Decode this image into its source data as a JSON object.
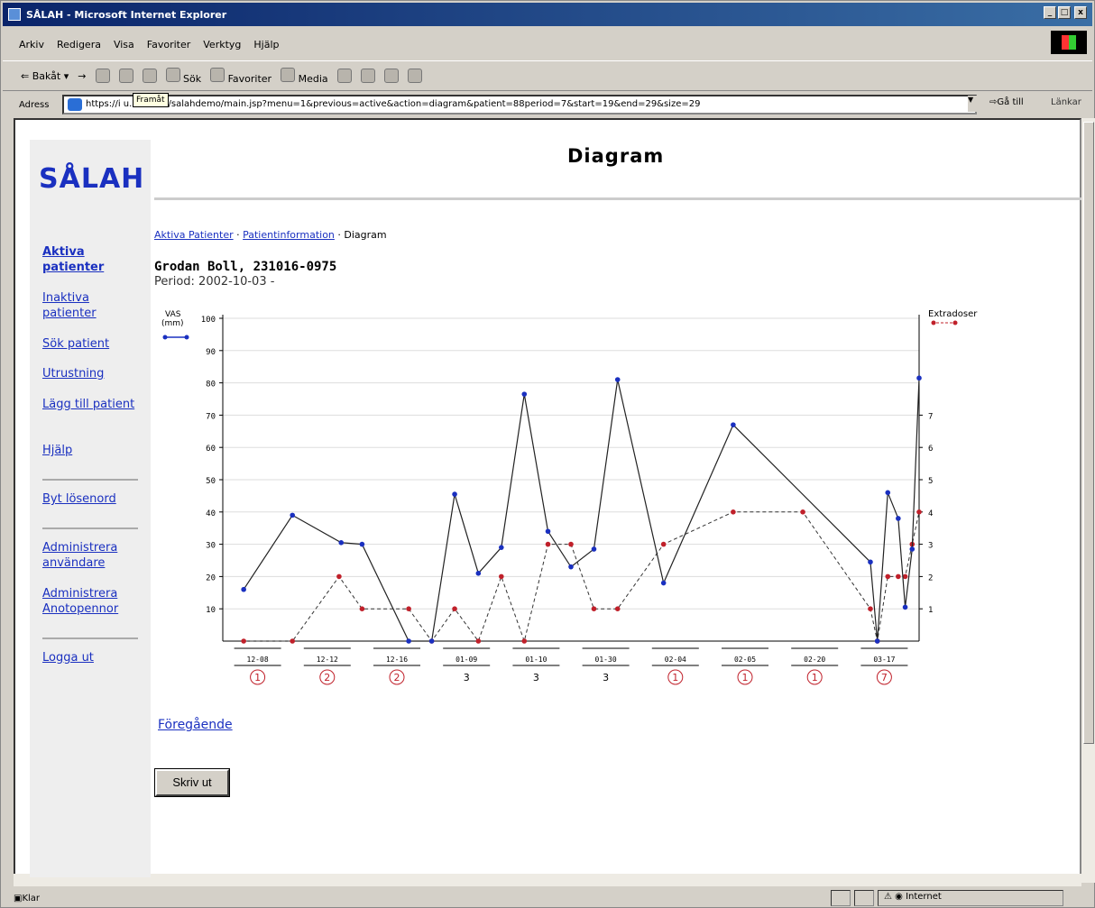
{
  "window": {
    "title": "SÅLAH - Microsoft Internet Explorer",
    "controls": {
      "minimize": "_",
      "restore": "□",
      "close": "x"
    }
  },
  "menubar": {
    "items": [
      "Arkiv",
      "Redigera",
      "Visa",
      "Favoriter",
      "Verktyg",
      "Hjälp"
    ]
  },
  "toolbar": {
    "back": "Bakåt",
    "forward": "→",
    "search": "Sök",
    "favorites": "Favoriter",
    "media": "Media"
  },
  "address": {
    "label": "Adress",
    "url": "https://i         u.se:8443/salahdemo/main.jsp?menu=1&previous=active&action=diagram&patient=88period=7&start=19&end=29&size=29",
    "tooltip": "Framåt",
    "go": "Gå till",
    "links": "Länkar"
  },
  "status": {
    "text": "Klar",
    "zone": "Internet"
  },
  "sidebar": {
    "logo": "SÅLAH",
    "links": [
      "Aktiva patienter",
      "Inaktiva patienter",
      "Sök patient",
      "Utrustning",
      "Lägg till patient",
      "Hjälp",
      "Byt lösenord",
      "Administrera användare",
      "Administrera Anotopennor",
      "Logga ut"
    ]
  },
  "main": {
    "title": "Diagram",
    "breadcrumb": {
      "crumb1": "Aktiva Patienter",
      "crumb2": "Patientinformation",
      "current": "Diagram",
      "sep": "·"
    },
    "patient": "Grodan Boll, 231016-0975",
    "period": "Period: 2002-10-03 -",
    "prev_link": "Föregående",
    "print_button": "Skriv ut"
  },
  "chart_data": {
    "type": "line",
    "left_axis_label_line1": "VAS",
    "left_axis_label_line2": "(mm)",
    "right_axis_label": "Extradoser",
    "ylim": [
      0,
      100
    ],
    "yticks": [
      10,
      20,
      30,
      40,
      50,
      60,
      70,
      80,
      90,
      100
    ],
    "y2lim": [
      0,
      10
    ],
    "y2ticks": [
      1,
      2,
      3,
      4,
      5,
      6,
      7
    ],
    "colors": {
      "vas": "#1a30c0",
      "extra": "#c0202a",
      "line": "#222222"
    },
    "groups": [
      {
        "date": "12-08",
        "count": "1",
        "circled": true
      },
      {
        "date": "12-12",
        "count": "2",
        "circled": true
      },
      {
        "date": "12-16",
        "count": "2",
        "circled": true
      },
      {
        "date": "01-09",
        "count": "3",
        "circled": false
      },
      {
        "date": "01-10",
        "count": "3",
        "circled": false
      },
      {
        "date": "01-30",
        "count": "3",
        "circled": false
      },
      {
        "date": "02-04",
        "count": "1",
        "circled": true
      },
      {
        "date": "02-05",
        "count": "1",
        "circled": true
      },
      {
        "date": "02-20",
        "count": "1",
        "circled": true
      },
      {
        "date": "03-17",
        "count": "7",
        "circled": true
      }
    ],
    "series": [
      {
        "name": "VAS",
        "style": "solid",
        "points": [
          [
            0.3,
            16
          ],
          [
            1,
            39
          ],
          [
            1.7,
            30.5
          ],
          [
            2,
            30
          ],
          [
            2.67,
            0
          ],
          [
            3,
            0
          ],
          [
            3.33,
            45.5
          ],
          [
            3.67,
            21
          ],
          [
            4,
            29
          ],
          [
            4.33,
            76.5
          ],
          [
            4.67,
            34
          ],
          [
            5,
            23
          ],
          [
            5.33,
            28.5
          ],
          [
            5.67,
            81
          ],
          [
            6.33,
            18
          ],
          [
            7.33,
            67
          ],
          [
            9.3,
            24.5
          ],
          [
            9.4,
            0
          ],
          [
            9.55,
            46
          ],
          [
            9.7,
            38
          ],
          [
            9.8,
            10.5
          ],
          [
            9.9,
            28.5
          ],
          [
            10,
            81.5
          ]
        ]
      },
      {
        "name": "Extradoser",
        "style": "dashed",
        "points": [
          [
            0.3,
            0
          ],
          [
            1,
            0
          ],
          [
            1.67,
            2
          ],
          [
            2,
            1
          ],
          [
            2.67,
            1
          ],
          [
            3,
            0
          ],
          [
            3.33,
            1
          ],
          [
            3.67,
            0
          ],
          [
            4,
            2
          ],
          [
            4.33,
            0
          ],
          [
            4.67,
            3
          ],
          [
            5,
            3
          ],
          [
            5.33,
            1
          ],
          [
            5.67,
            1
          ],
          [
            6.33,
            3
          ],
          [
            7.33,
            4
          ],
          [
            8.33,
            4
          ],
          [
            9.3,
            1
          ],
          [
            9.4,
            0
          ],
          [
            9.55,
            2
          ],
          [
            9.7,
            2
          ],
          [
            9.8,
            2
          ],
          [
            9.9,
            3
          ],
          [
            10,
            4
          ]
        ]
      }
    ]
  }
}
